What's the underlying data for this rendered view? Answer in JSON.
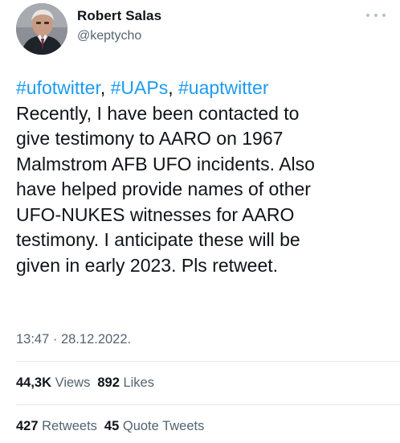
{
  "author": {
    "display_name": "Robert Salas",
    "handle": "@keptycho",
    "avatar_icon": "profile-photo"
  },
  "tweet": {
    "hashtags": [
      "#ufotwitter",
      "#UAPs",
      "#uaptwitter"
    ],
    "hashtag_separator": ", ",
    "text": "Recently, I have been contacted to\ngive testimony to AARO on 1967\nMalmstrom AFB UFO incidents. Also\nhave helped provide names of other\nUFO-NUKES witnesses for AARO\ntestimony. I anticipate these will be\ngiven in early 2023. Pls retweet.",
    "timestamp": "13:47 · 28.12.2022."
  },
  "stats": {
    "views_count": "44,3K",
    "views_label": "Views",
    "likes_count": "892",
    "likes_label": "Likes",
    "retweets_count": "427",
    "retweets_label": "Retweets",
    "quote_count": "45",
    "quote_label": "Quote Tweets"
  },
  "colors": {
    "link": "#1d9bf0",
    "secondary_text": "#536471",
    "primary_text": "#0f1419"
  }
}
